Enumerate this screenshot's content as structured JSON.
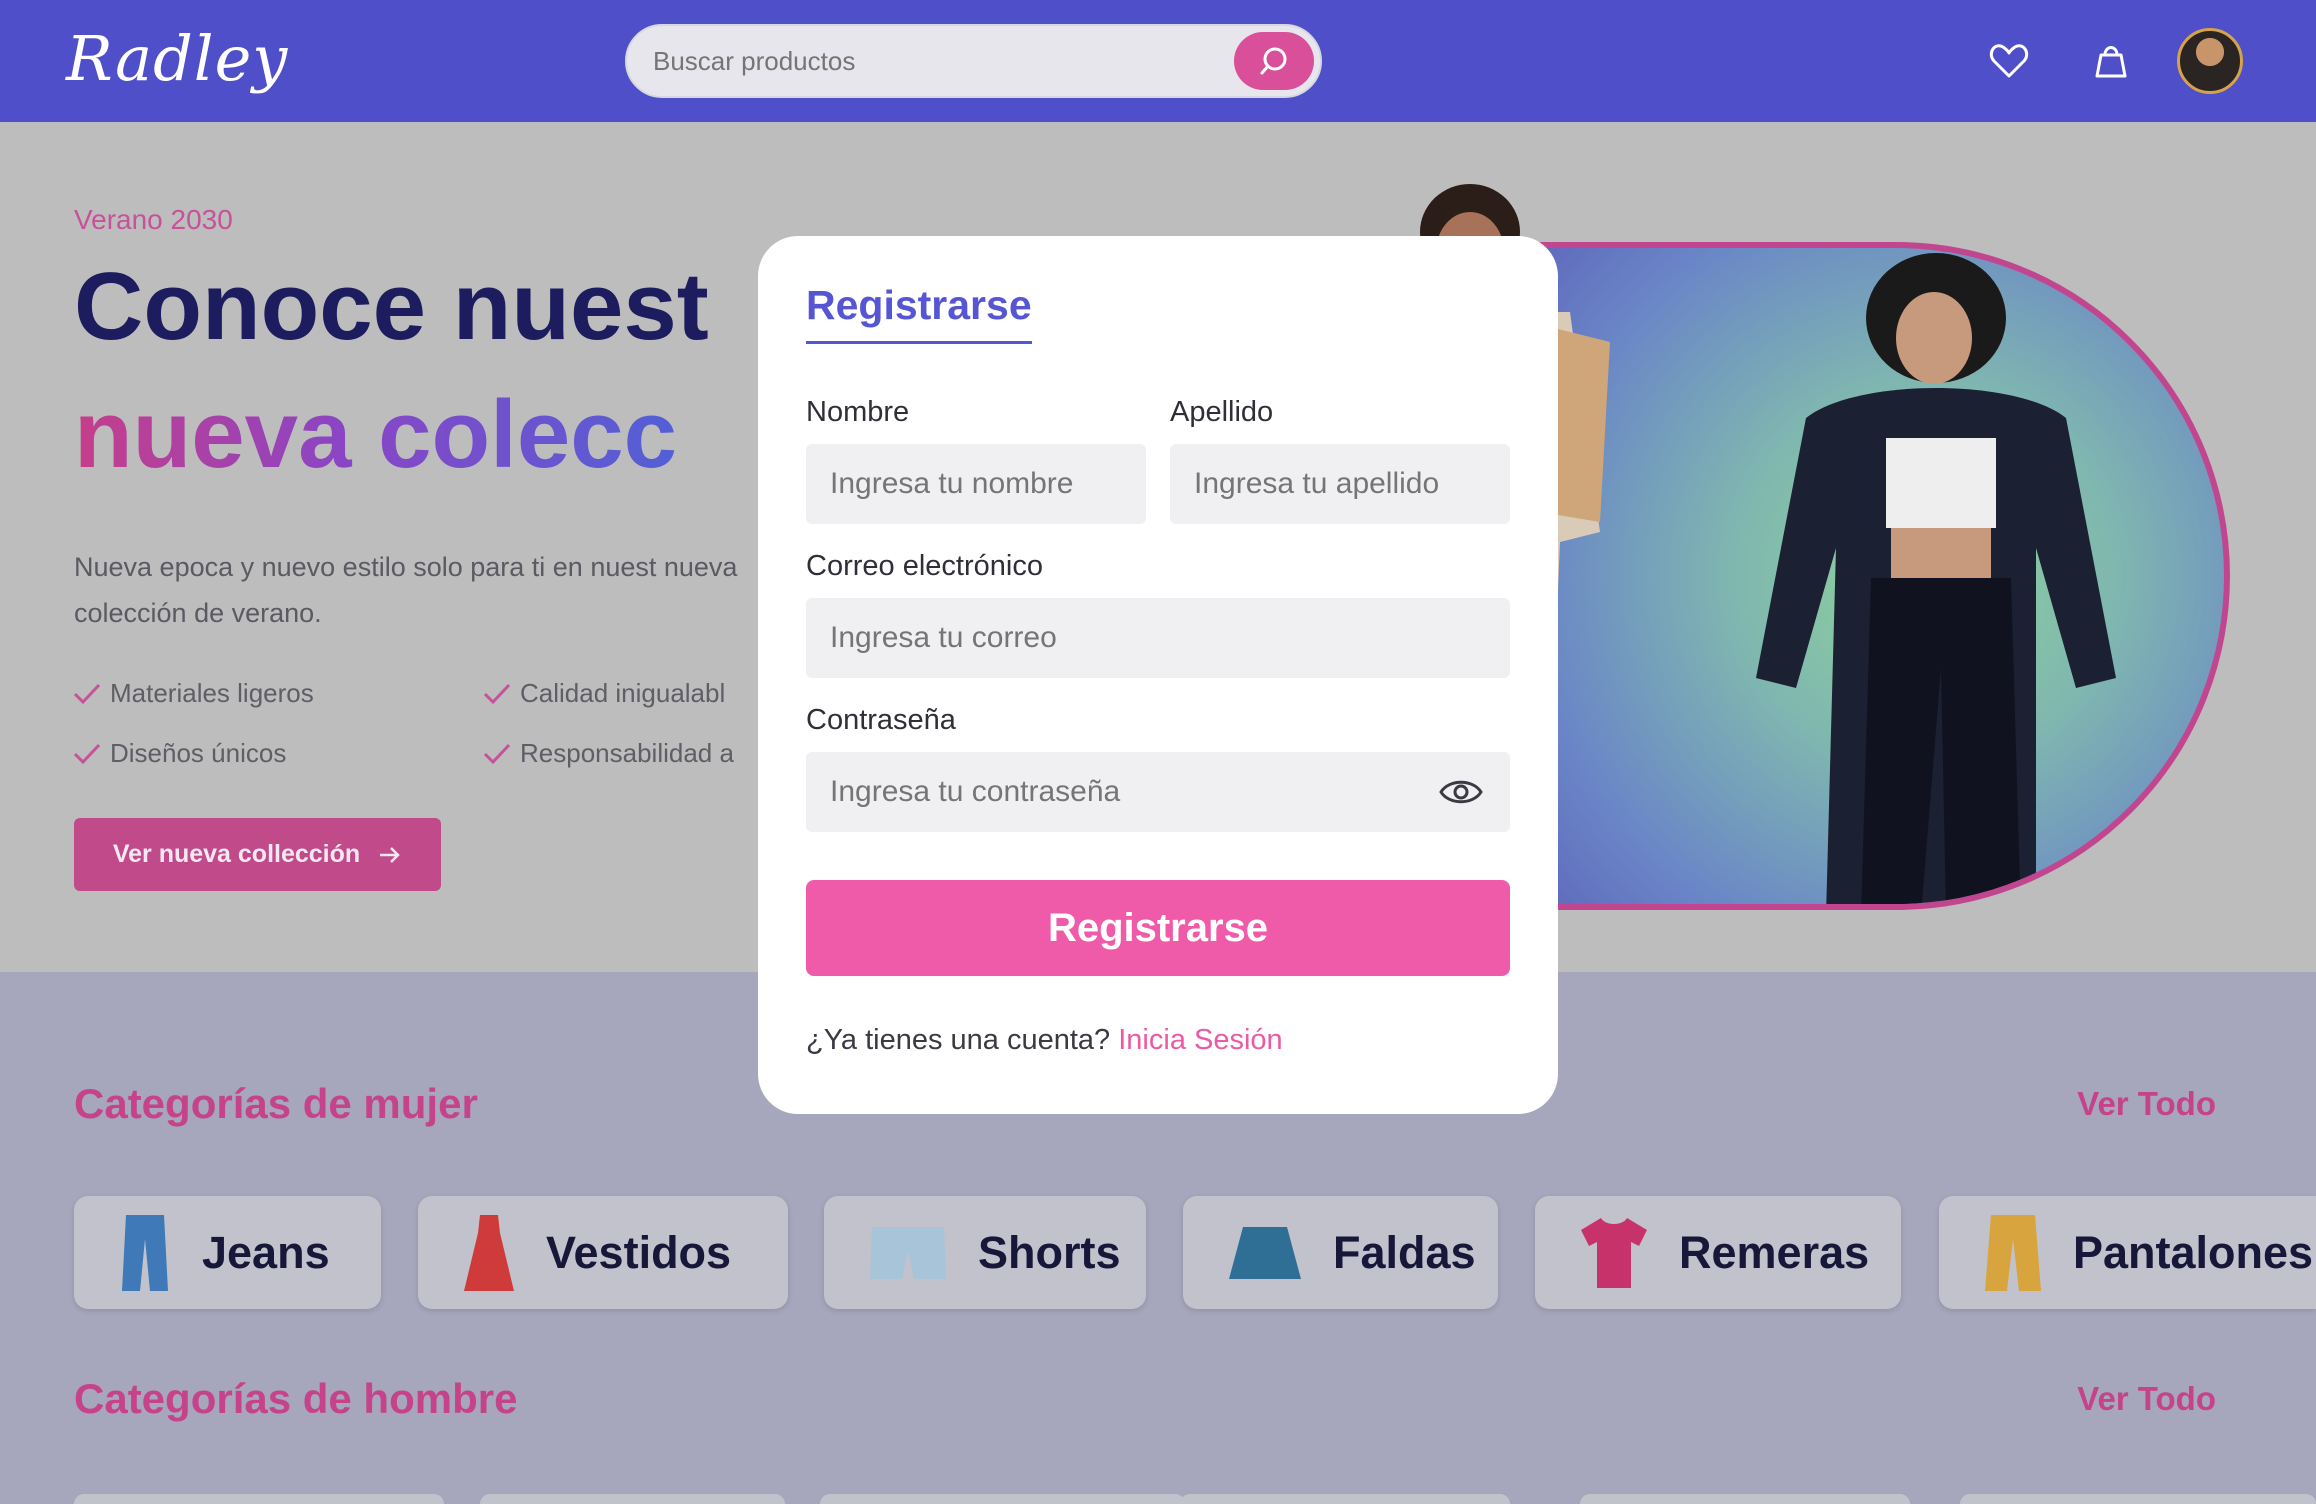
{
  "header": {
    "logo": "Radley",
    "search_placeholder": "Buscar productos",
    "icons": [
      "heart-icon",
      "bag-icon",
      "search-icon"
    ]
  },
  "hero": {
    "eyebrow": "Verano 2030",
    "title_line1": "Conoce nuest",
    "title_line2": "nueva colecc",
    "description": "Nueva epoca y nuevo estilo solo para ti en nuest nueva colección de verano.",
    "features": [
      "Materiales ligeros",
      "Calidad inigualabl",
      "Diseños únicos",
      "Responsabilidad a"
    ],
    "cta": "Ver nueva collección"
  },
  "women": {
    "title": "Categorías de mujer",
    "see_all": "Ver Todo",
    "categories": [
      "Jeans",
      "Vestidos",
      "Shorts",
      "Faldas",
      "Remeras",
      "Pantalones"
    ]
  },
  "men": {
    "title": "Categorías de hombre",
    "see_all": "Ver Todo"
  },
  "modal": {
    "tab": "Registrarse",
    "first_name_label": "Nombre",
    "first_name_placeholder": "Ingresa tu nombre",
    "last_name_label": "Apellido",
    "last_name_placeholder": "Ingresa tu apellido",
    "email_label": "Correo electrónico",
    "email_placeholder": "Ingresa tu correo",
    "password_label": "Contraseña",
    "password_placeholder": "Ingresa tu contraseña",
    "submit": "Registrarse",
    "footer_text": "¿Ya tienes una cuenta?",
    "footer_link": "Inicia Sesión"
  },
  "colors": {
    "header": "#4f4fc9",
    "accent_pink": "#ef5ba9",
    "accent_purple": "#5656d4"
  }
}
